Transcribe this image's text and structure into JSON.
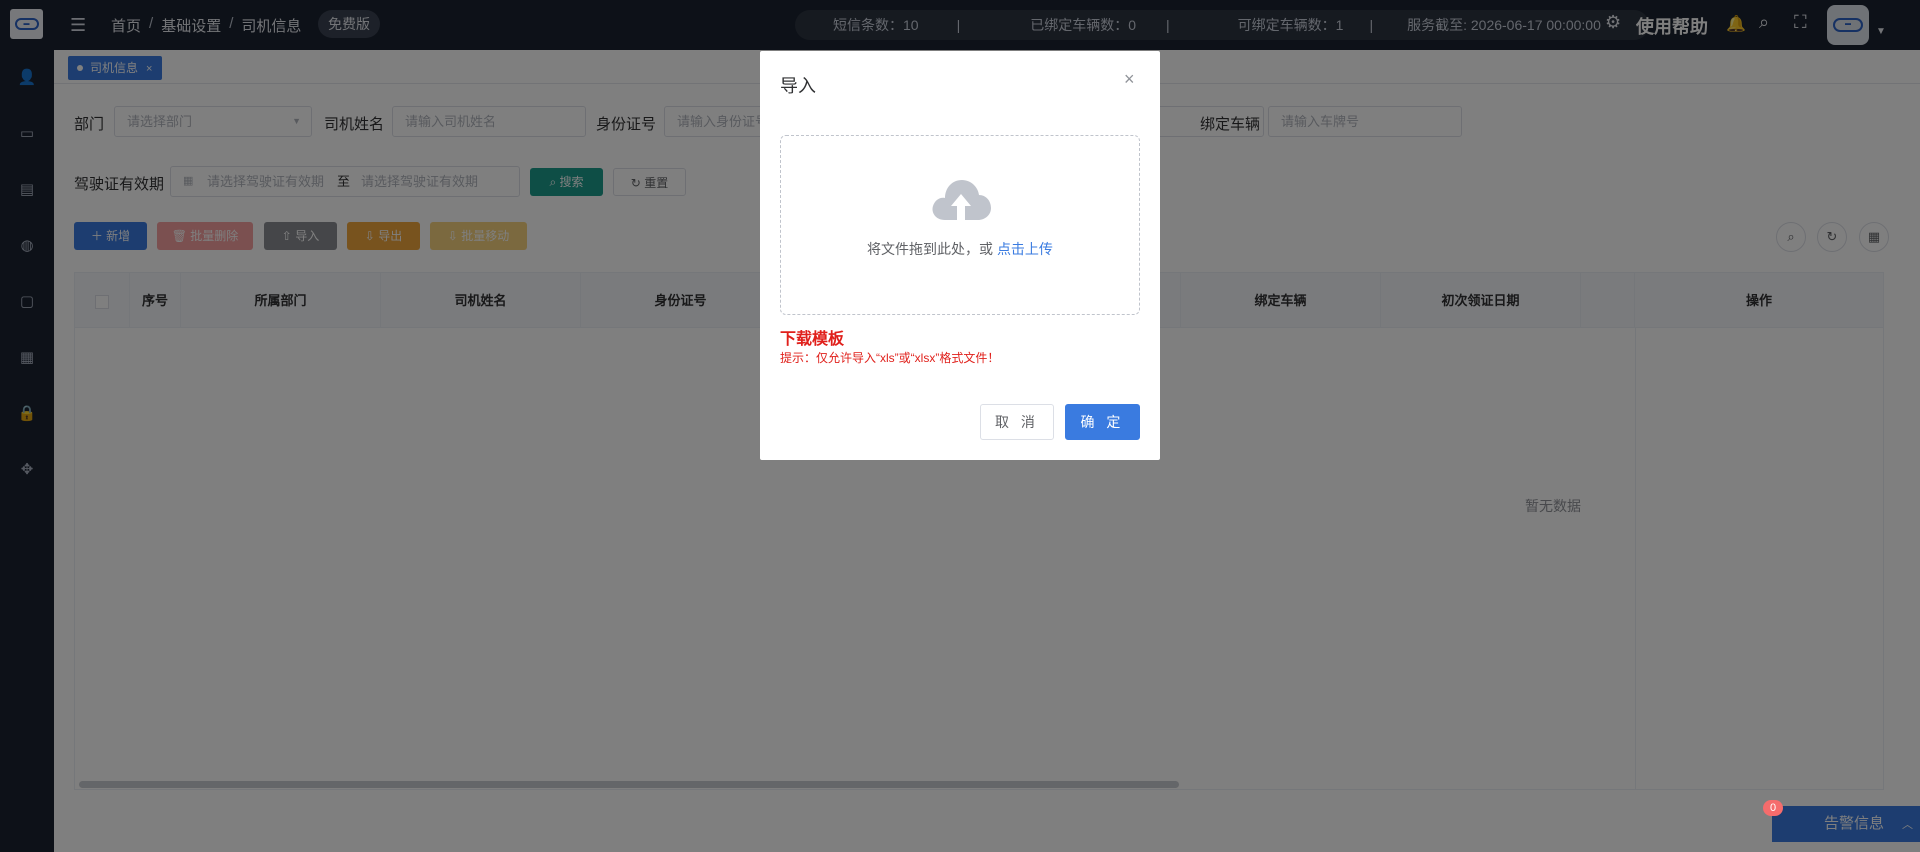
{
  "header": {
    "breadcrumb": [
      "首页",
      "基础设置",
      "司机信息"
    ],
    "plan_badge": "免费版",
    "sms_count": "短信条数：10",
    "bound_vehicles": "已绑定车辆数：0",
    "bindable_vehicles": "可绑定车辆数：1",
    "service_until": "服务截至: 2026-06-17 00:00:00",
    "help": "使用帮助",
    "separator": "|"
  },
  "tags": {
    "active_tag": "司机信息",
    "close": "×"
  },
  "filters": {
    "department_label": "部门",
    "department_placeholder": "请选择部门",
    "driver_name_label": "司机姓名",
    "driver_name_placeholder": "请输入司机姓名",
    "id_label": "身份证号",
    "id_placeholder": "请输入身份证号",
    "vehicle_label": "绑定车辆",
    "vehicle_placeholder": "请输入车牌号",
    "license_label": "驾驶证有效期",
    "license_start_placeholder": "请选择驾驶证有效期",
    "to": "至",
    "license_end_placeholder": "请选择驾驶证有效期",
    "search": "搜索",
    "reset": "重置"
  },
  "toolbar": {
    "add": "新增",
    "batch_delete": "批量删除",
    "import": "导入",
    "export": "导出",
    "batch_move": "批量移动"
  },
  "table": {
    "columns": [
      "序号",
      "所属部门",
      "司机姓名",
      "身份证号",
      "绑定车辆",
      "初次领证日期",
      "操作"
    ],
    "empty_text": "暂无数据"
  },
  "alert": {
    "count": "0",
    "label": "告警信息"
  },
  "modal": {
    "title": "导入",
    "close": "×",
    "drop_text": "将文件拖到此处，或",
    "upload_link": "点击上传",
    "download_template": "下载模板",
    "tip": "提示：仅允许导入“xls”或“xlsx”格式文件！",
    "cancel": "取 消",
    "confirm": "确 定"
  },
  "colors": {
    "primary": "#3a7be0",
    "danger_text": "#e0201b",
    "sidebar_bg": "#1b2330"
  }
}
